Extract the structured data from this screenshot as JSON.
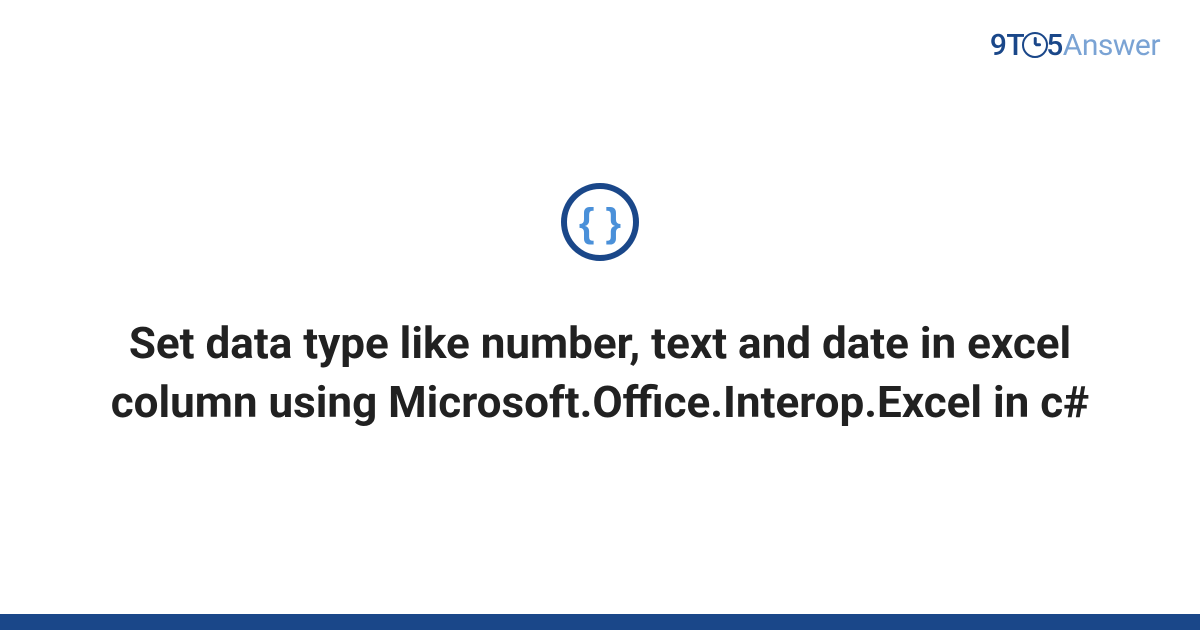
{
  "logo": {
    "part1": "9",
    "part2": "T",
    "part3": "5",
    "part4": "Answer"
  },
  "main": {
    "title": "Set data type like number, text and date in excel column using Microsoft.Office.Interop.Excel in c#"
  },
  "colors": {
    "brand_dark": "#1a4789",
    "brand_light": "#7aa3d4",
    "icon_inner": "#4a90d9"
  }
}
